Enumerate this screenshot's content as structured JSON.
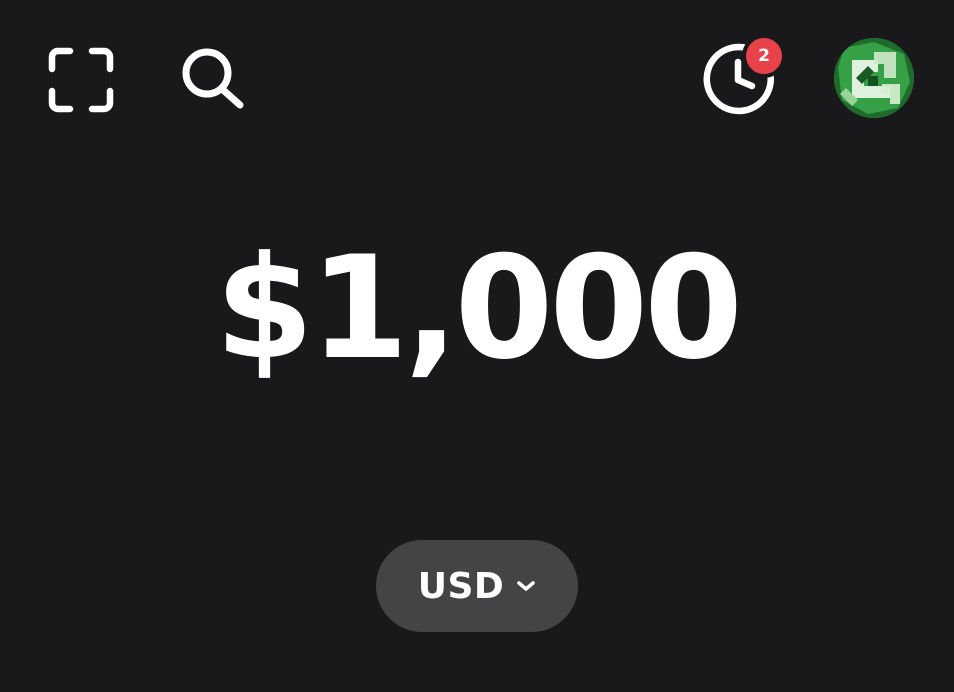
{
  "header": {
    "left_icons": [
      "scan-icon",
      "search-icon"
    ],
    "right_icons": [
      "clock-icon",
      "avatar"
    ],
    "activity_badge_count": "2"
  },
  "balance": {
    "amount": "$1,000"
  },
  "currency_selector": {
    "label": "USD",
    "icon": "chevron-down-icon"
  },
  "colors": {
    "background": "#19191b",
    "text": "#ffffff",
    "badge": "#e8434b",
    "pill": "#444446",
    "avatar_green": "#2e8b3e"
  }
}
